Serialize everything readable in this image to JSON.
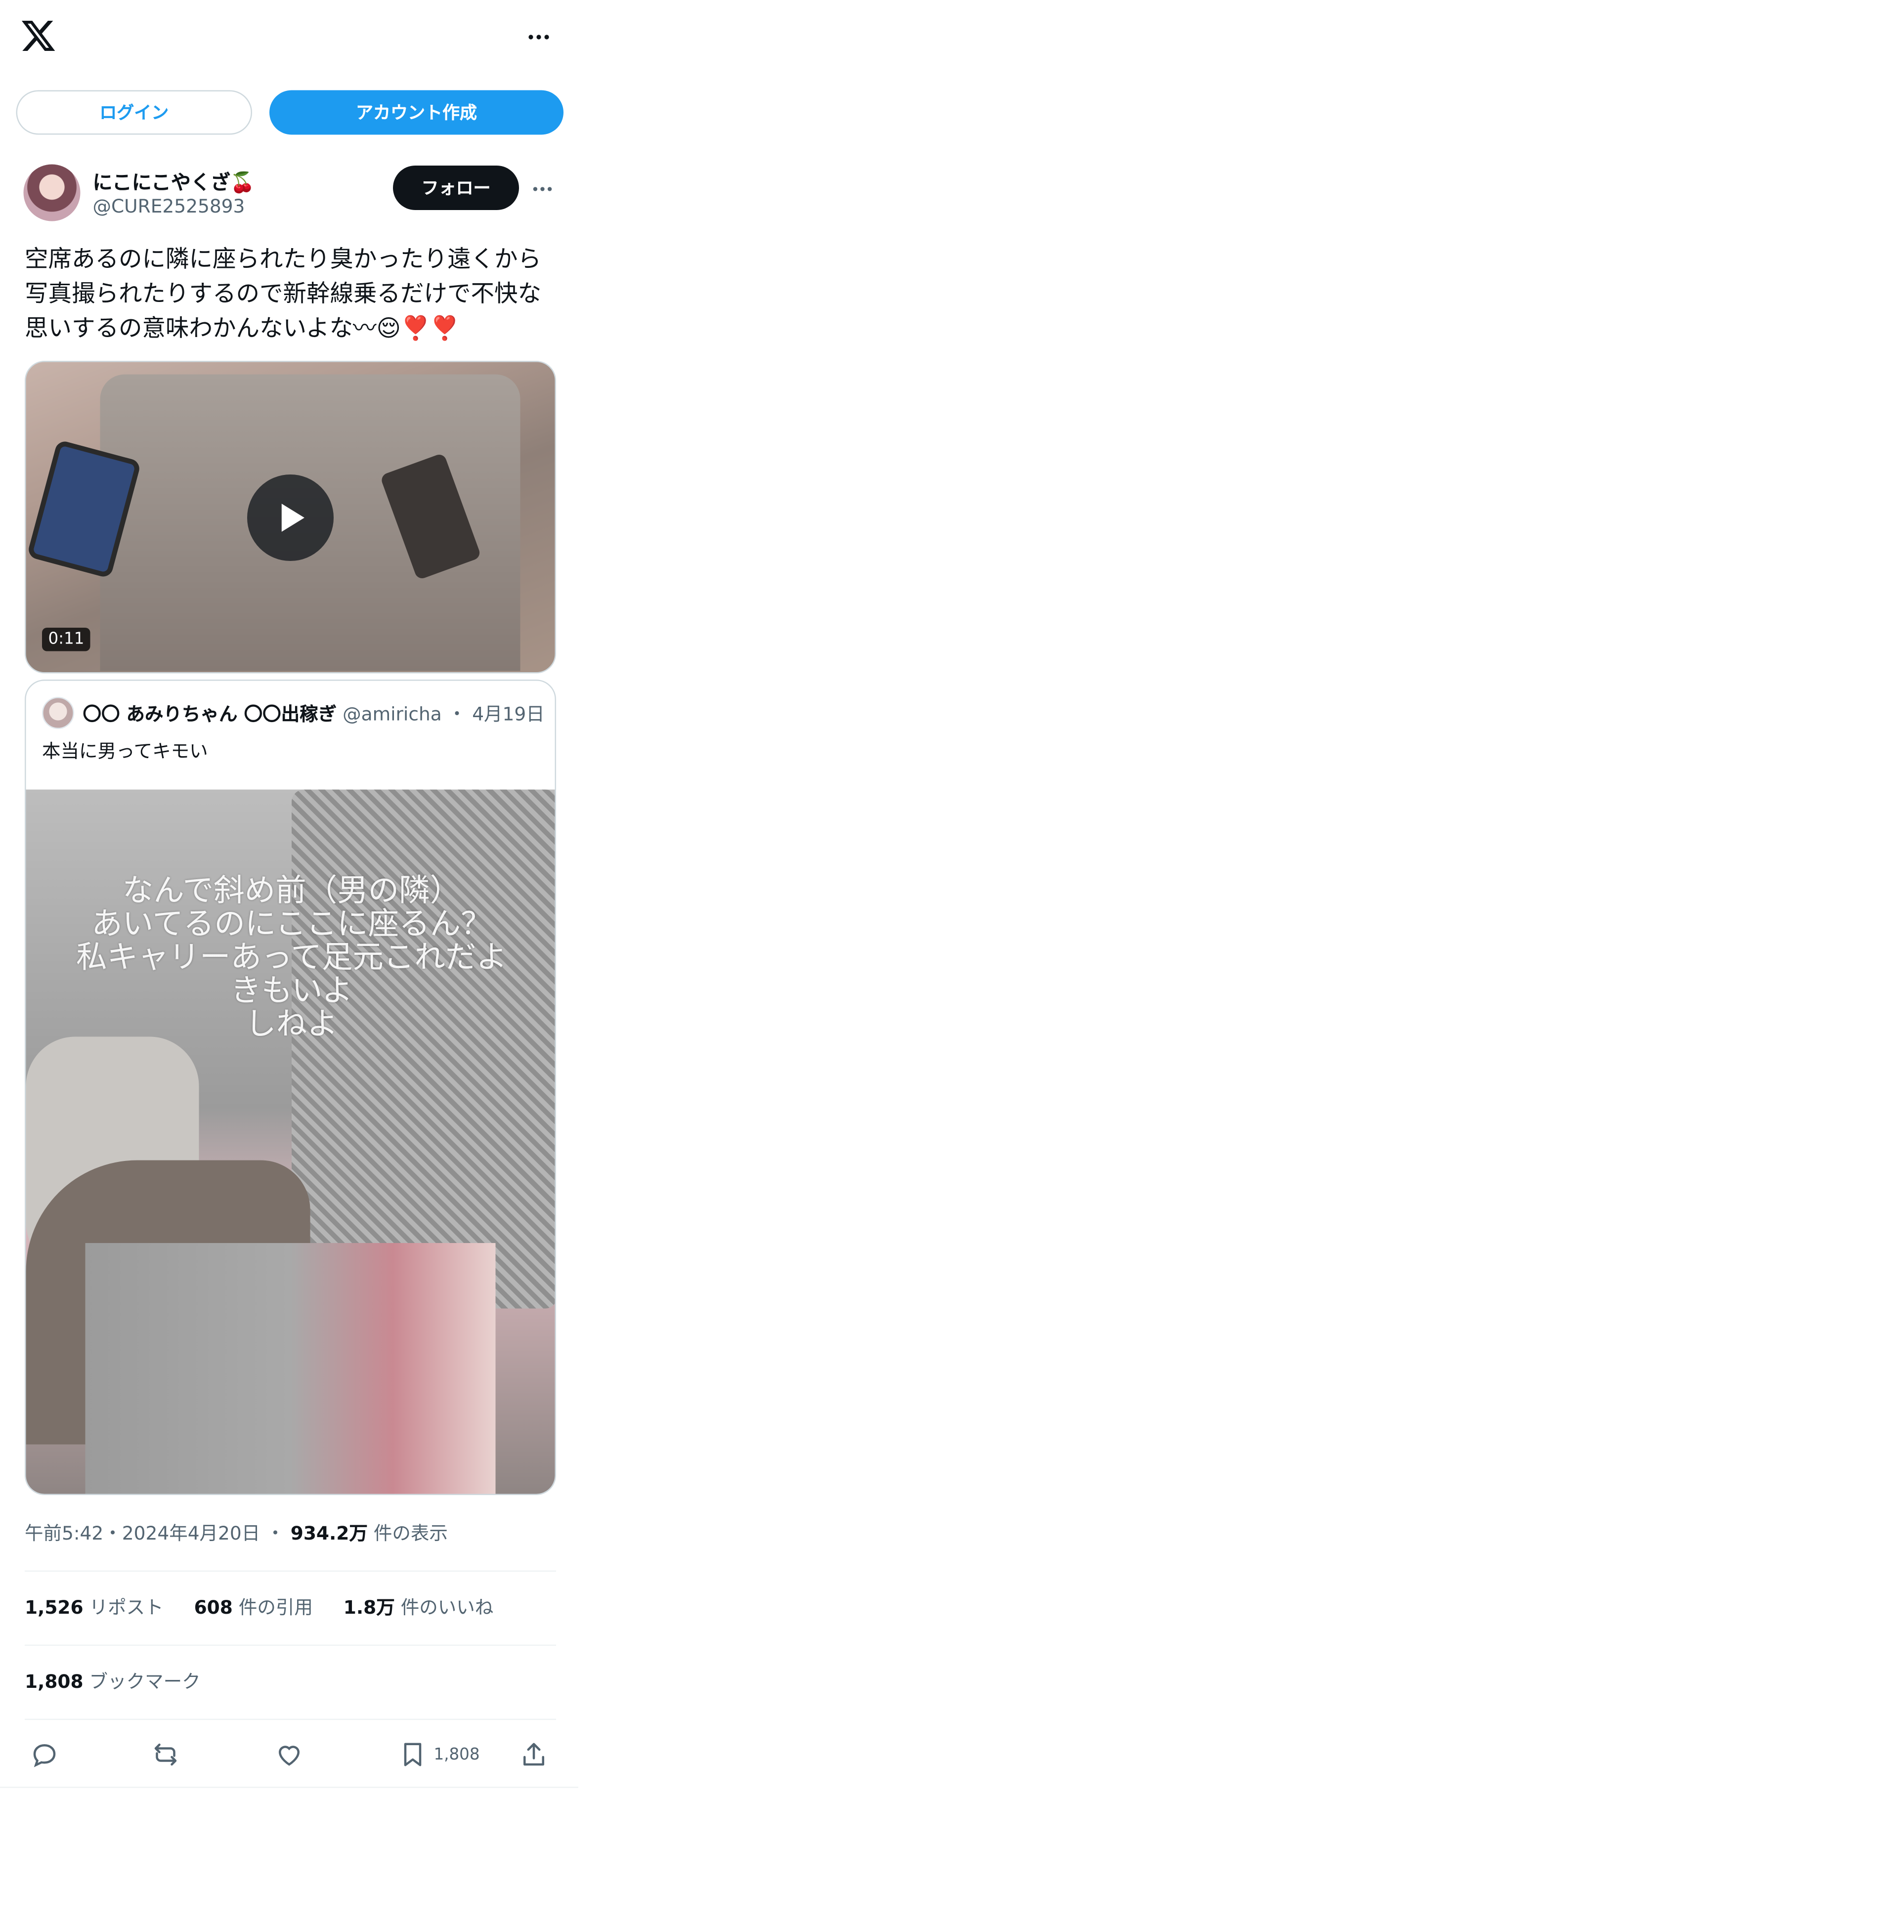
{
  "header": {
    "logo_icon": "x-logo-icon",
    "more_icon": "more-horizontal-icon"
  },
  "auth": {
    "login_label": "ログイン",
    "signup_label": "アカウント作成"
  },
  "post": {
    "author": {
      "display_name": "にこにこやくざ🍒",
      "handle": "@CURE2525893"
    },
    "follow_label": "フォロー",
    "text": "空席あるのに隣に座られたり臭かったり遠くから\n写真撮られたりするので新幹線乗るだけで不快な\n思いするの意味わかんないよな〰😌❣️❣️",
    "video": {
      "duration": "0:11"
    },
    "quote": {
      "display_name": "〇〇 あみりちゃん 〇〇出稼ぎ",
      "handle": "@amiricha",
      "separator": "・",
      "date": "4月19日",
      "text": "本当に男ってキモい",
      "image_overlay_text": "なんで斜め前（男の隣）\nあいてるのにここに座るん？\n私キャリーあって足元これだよ\nきもいよ\nしねよ"
    },
    "time": "午前5:42",
    "date": "2024年4月20日",
    "dot": "・",
    "views_count": "934.2万",
    "views_label": "件の表示",
    "stats": {
      "reposts_count": "1,526",
      "reposts_label": "リポスト",
      "quotes_count": "608",
      "quotes_label": "件の引用",
      "likes_count": "1.8万",
      "likes_label": "件のいいね",
      "bookmarks_count": "1,808",
      "bookmarks_label": "ブックマーク"
    },
    "actions": {
      "bookmark_count": "1,808"
    }
  },
  "colors": {
    "accent": "#1d9bf0",
    "text_primary": "#0f1419",
    "text_secondary": "#536471",
    "border": "#cfd9de"
  }
}
